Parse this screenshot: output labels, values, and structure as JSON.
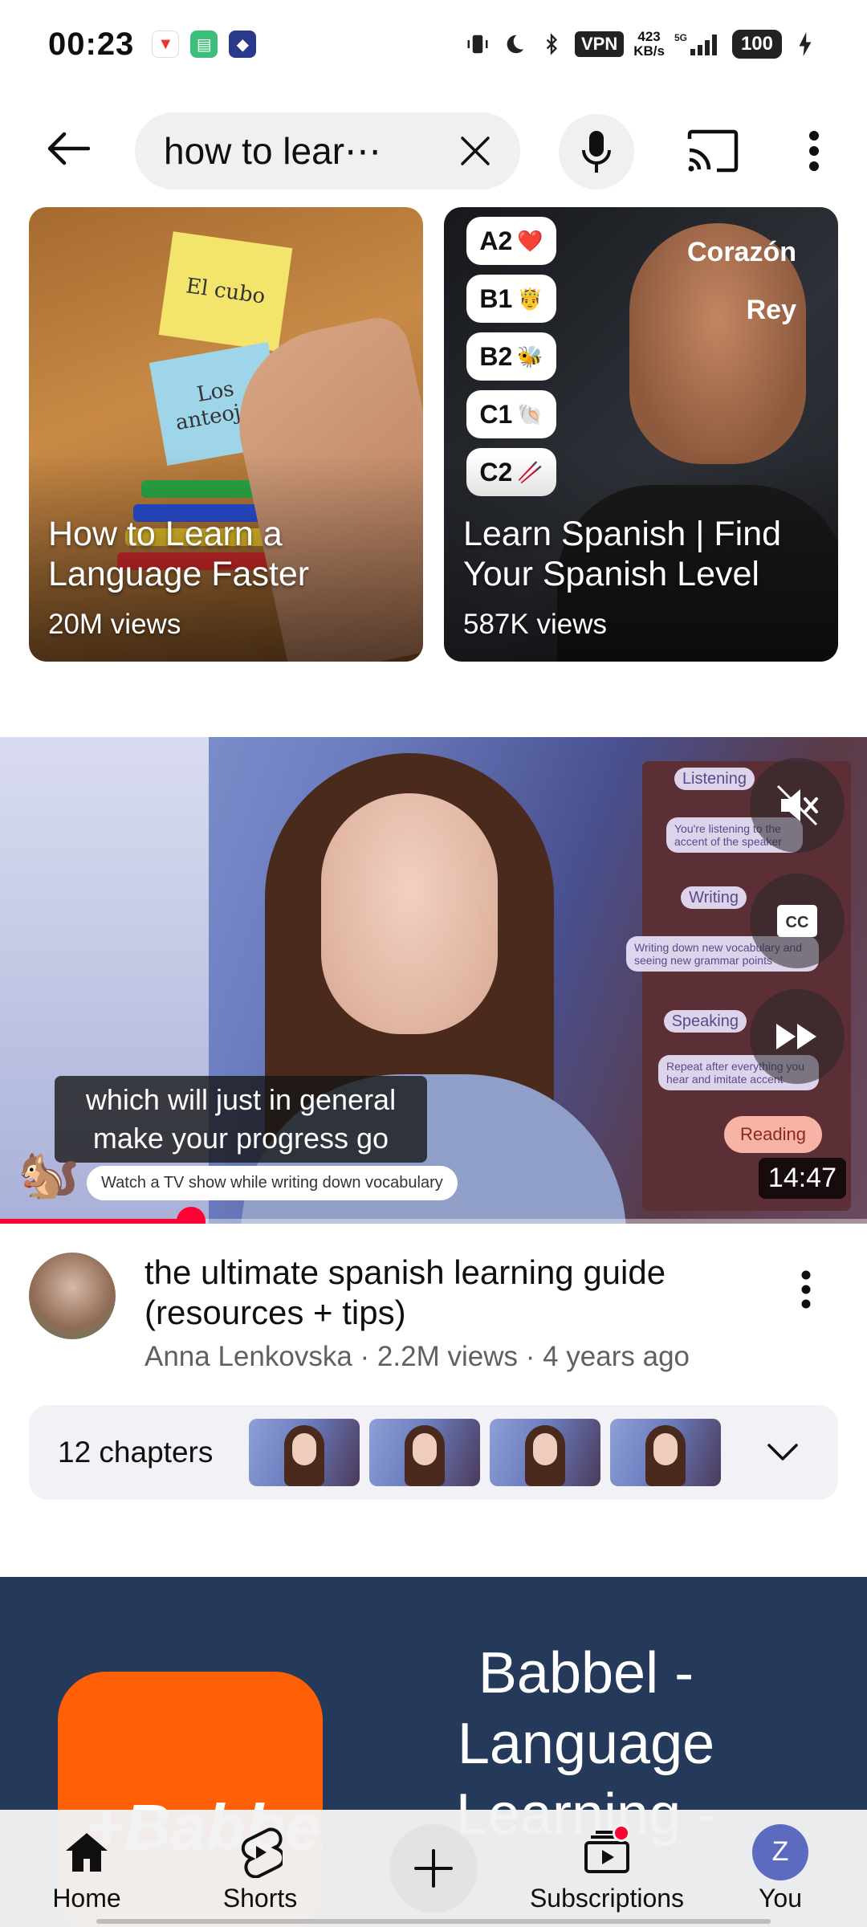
{
  "status_bar": {
    "time": "00:23",
    "vpn": "VPN",
    "speed_value": "423",
    "speed_unit": "KB/s",
    "network": "5G",
    "battery": "100"
  },
  "search": {
    "query": "how to lear⋯"
  },
  "shorts": [
    {
      "title": "How to Learn a Language Faster",
      "views": "20M views",
      "notes": [
        "El cubo",
        "Los anteojos"
      ]
    },
    {
      "title": "Learn Spanish | Find Your Spanish Level",
      "views": "587K views",
      "levels": [
        {
          "label": "A2",
          "emoji": "❤️"
        },
        {
          "label": "B1",
          "emoji": "🤴"
        },
        {
          "label": "B2",
          "emoji": "🐝"
        },
        {
          "label": "C1",
          "emoji": "🐚"
        },
        {
          "label": "C2",
          "emoji": "🥢"
        }
      ],
      "overlay_lines": [
        "Corazón",
        "Rey"
      ]
    }
  ],
  "video": {
    "caption": "which will just in general make your progress go",
    "tv_pill": "Watch a TV show while writing down vocabulary",
    "duration": "14:47",
    "reading_pill": "Reading",
    "progress_fraction": 0.22,
    "notes": [
      "Listening",
      "You're listening to the accent of the speaker",
      "Writing",
      "Writing down new vocabulary and seeing new grammar points",
      "Speaking",
      "Repeat after everything you hear and imitate accent"
    ],
    "title": "the ultimate spanish learning guide (resources + tips)",
    "channel": "Anna Lenkovska",
    "views": "2.2M views",
    "age": "4 years ago",
    "chapters_label": "12 chapters"
  },
  "ad": {
    "logo_text": "+Babbel",
    "title": "Babbel - Language Learning -"
  },
  "bottom_nav": {
    "home": "Home",
    "shorts": "Shorts",
    "subscriptions": "Subscriptions",
    "you": "You",
    "you_initial": "Z"
  },
  "colors": {
    "accent_red": "#ff0033",
    "babbel_orange": "#ff5f05",
    "ad_background": "#253a5a"
  }
}
